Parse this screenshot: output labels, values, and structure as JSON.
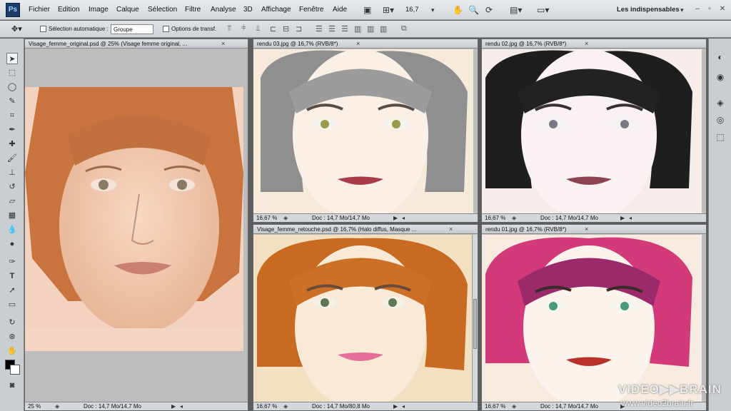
{
  "app": {
    "logo": "Ps"
  },
  "menu": [
    "Fichier",
    "Edition",
    "Image",
    "Calque",
    "Sélection",
    "Filtre",
    "Analyse",
    "3D",
    "Affichage",
    "Fenêtre",
    "Aide"
  ],
  "menubar": {
    "zoom": "16,7",
    "workspace": "Les indispensables"
  },
  "options": {
    "auto_select_label": "Sélection automatique :",
    "group_value": "Groupe",
    "transform_label": "Options de transf."
  },
  "documents": {
    "original": {
      "title": "Visage_femme_original.psd @ 25% (Visage femme original, ...",
      "zoom": "25 %",
      "doc": "Doc : 14,7 Mo/14,7 Mo"
    },
    "rendu03": {
      "title": "rendu 03.jpg @ 16,7% (RVB/8*)",
      "zoom": "16,67 %",
      "doc": "Doc : 14,7 Mo/14,7 Mo"
    },
    "rendu02": {
      "title": "rendu 02.jpg @ 16,7% (RVB/8*)",
      "zoom": "16,67 %",
      "doc": "Doc : 14,7 Mo/14,7 Mo"
    },
    "retouche": {
      "title": "Visage_femme_retouche.psd @ 16,7% (Halo diffus, Masque ...",
      "zoom": "16,67 %",
      "doc": "Doc : 14,7 Mo/80,8 Mo"
    },
    "rendu01": {
      "title": "rendu 01.jpg @ 16,7% (RVB/8*)",
      "zoom": "16,67 %",
      "doc": "Doc : 14,7 Mo/14,7 Mo"
    }
  },
  "watermark": {
    "brand": "VIDEO▶▶BRAIN",
    "url": "www.video2brain.fr"
  },
  "colors": {
    "accent": "#1a3d6b",
    "hair_gray": "#8f8f8f",
    "hair_black": "#1e1e1e",
    "hair_copper": "#c86a22",
    "hair_pink": "#d23a7a",
    "hair_auburn": "#b06a44"
  }
}
